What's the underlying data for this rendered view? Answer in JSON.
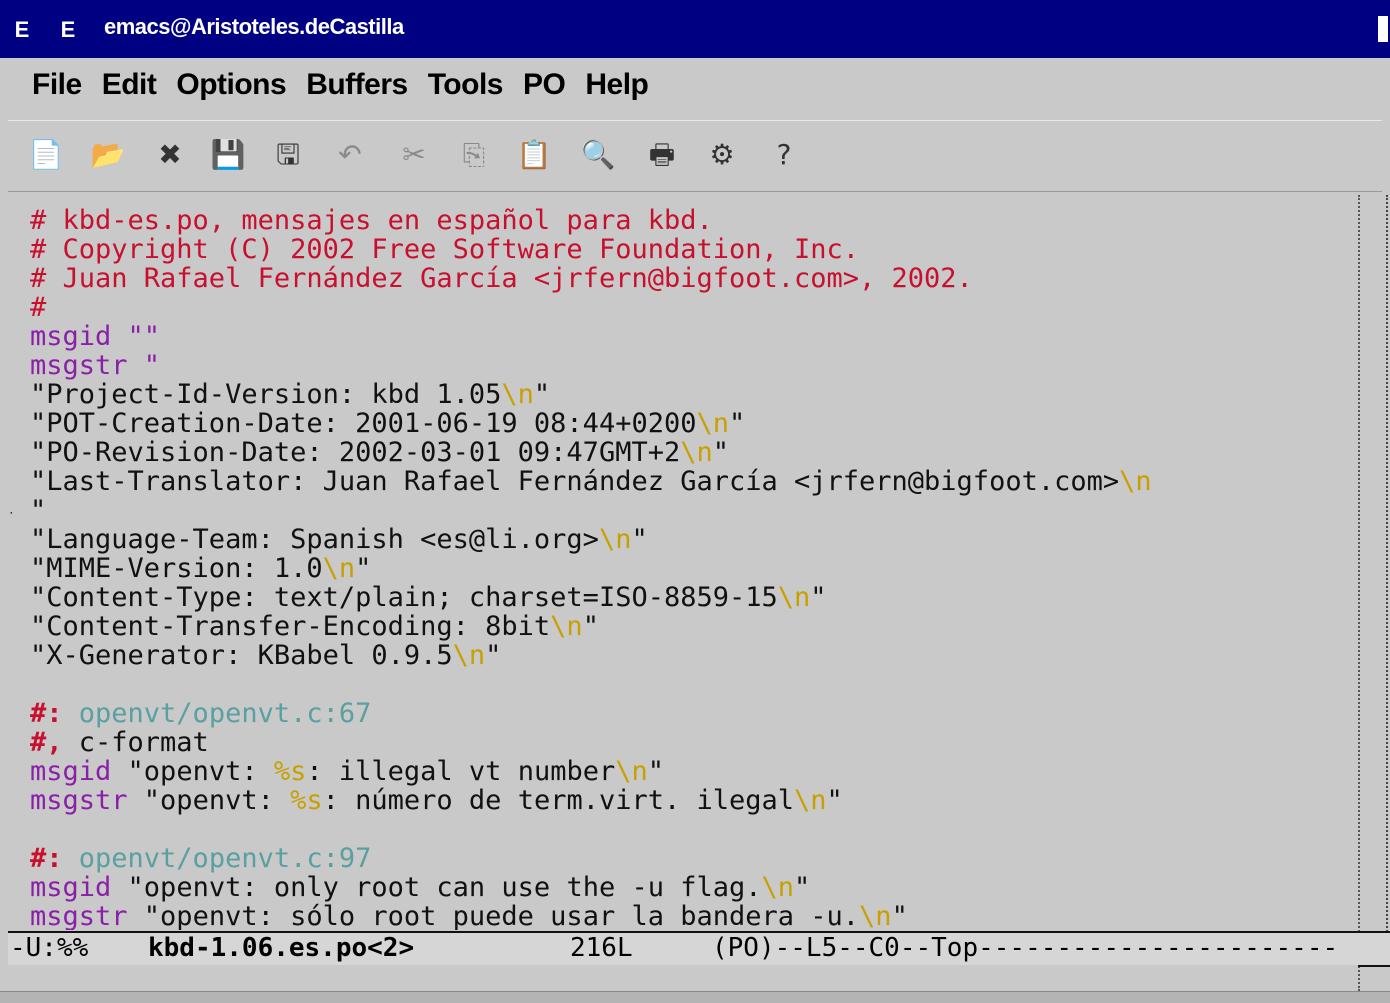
{
  "window": {
    "icon_left": "E",
    "icon_left2": "E",
    "title": "emacs@Aristoteles.deCastilla"
  },
  "menu": [
    "File",
    "Edit",
    "Options",
    "Buffers",
    "Tools",
    "PO",
    "Help"
  ],
  "toolbar": {
    "icons": [
      "open-file-icon",
      "open-dir-icon",
      "close-icon",
      "save-icon",
      "save-as-icon",
      "undo-icon",
      "cut-icon",
      "copy-icon",
      "paste-icon",
      "search-icon",
      "print-icon",
      "customize-icon",
      "help-icon"
    ]
  },
  "buffer": {
    "lines": [
      {
        "seg": [
          {
            "c": "comment",
            "t": "# kbd-es.po, mensajes en español para kbd."
          }
        ]
      },
      {
        "seg": [
          {
            "c": "comment",
            "t": "# Copyright (C) 2002 Free Software Foundation, Inc."
          }
        ]
      },
      {
        "seg": [
          {
            "c": "comment",
            "t": "# Juan Rafael Fernández García <jrfern@bigfoot.com>, 2002."
          }
        ]
      },
      {
        "seg": [
          {
            "c": "comment",
            "t": "#"
          }
        ]
      },
      {
        "seg": [
          {
            "c": "kw",
            "t": "msgid \"\""
          }
        ]
      },
      {
        "seg": [
          {
            "c": "kw",
            "t": "msgstr \""
          }
        ]
      },
      {
        "seg": [
          {
            "c": "",
            "t": "\"Project-Id-Version: kbd 1.05"
          },
          {
            "c": "esc",
            "t": "\\n"
          },
          {
            "c": "",
            "t": "\""
          }
        ]
      },
      {
        "seg": [
          {
            "c": "",
            "t": "\"POT-Creation-Date: 2001-06-19 08:44+0200"
          },
          {
            "c": "esc",
            "t": "\\n"
          },
          {
            "c": "",
            "t": "\""
          }
        ]
      },
      {
        "seg": [
          {
            "c": "",
            "t": "\"PO-Revision-Date: 2002-03-01 09:47GMT+2"
          },
          {
            "c": "esc",
            "t": "\\n"
          },
          {
            "c": "",
            "t": "\""
          }
        ]
      },
      {
        "seg": [
          {
            "c": "",
            "t": "\"Last-Translator: Juan Rafael Fernández García <jrfern@bigfoot.com>"
          },
          {
            "c": "esc",
            "t": "\\n"
          }
        ]
      },
      {
        "seg": [
          {
            "c": "",
            "t": "\""
          }
        ]
      },
      {
        "seg": [
          {
            "c": "",
            "t": "\"Language-Team: Spanish <es@li.org>"
          },
          {
            "c": "esc",
            "t": "\\n"
          },
          {
            "c": "",
            "t": "\""
          }
        ]
      },
      {
        "seg": [
          {
            "c": "",
            "t": "\"MIME-Version: 1.0"
          },
          {
            "c": "esc",
            "t": "\\n"
          },
          {
            "c": "",
            "t": "\""
          }
        ]
      },
      {
        "seg": [
          {
            "c": "",
            "t": "\"Content-Type: text/plain; charset=ISO-8859-15"
          },
          {
            "c": "esc",
            "t": "\\n"
          },
          {
            "c": "",
            "t": "\""
          }
        ]
      },
      {
        "seg": [
          {
            "c": "",
            "t": "\"Content-Transfer-Encoding: 8bit"
          },
          {
            "c": "esc",
            "t": "\\n"
          },
          {
            "c": "",
            "t": "\""
          }
        ]
      },
      {
        "seg": [
          {
            "c": "",
            "t": "\"X-Generator: KBabel 0.9.5"
          },
          {
            "c": "esc",
            "t": "\\n"
          },
          {
            "c": "",
            "t": "\""
          }
        ]
      },
      {
        "seg": [
          {
            "c": "",
            "t": ""
          }
        ]
      },
      {
        "seg": [
          {
            "c": "hash",
            "t": "#:"
          },
          {
            "c": "ref",
            "t": " openvt/openvt.c:67"
          }
        ]
      },
      {
        "seg": [
          {
            "c": "hash",
            "t": "#,"
          },
          {
            "c": "",
            "t": " c-format"
          }
        ]
      },
      {
        "seg": [
          {
            "c": "kw",
            "t": "msgid "
          },
          {
            "c": "",
            "t": "\"openvt: "
          },
          {
            "c": "esc",
            "t": "%s"
          },
          {
            "c": "",
            "t": ": illegal vt number"
          },
          {
            "c": "esc",
            "t": "\\n"
          },
          {
            "c": "",
            "t": "\""
          }
        ]
      },
      {
        "seg": [
          {
            "c": "kw",
            "t": "msgstr "
          },
          {
            "c": "",
            "t": "\"openvt: "
          },
          {
            "c": "esc",
            "t": "%s"
          },
          {
            "c": "",
            "t": ": número de term.virt. ilegal"
          },
          {
            "c": "esc",
            "t": "\\n"
          },
          {
            "c": "",
            "t": "\""
          }
        ]
      },
      {
        "seg": [
          {
            "c": "",
            "t": ""
          }
        ]
      },
      {
        "seg": [
          {
            "c": "hash",
            "t": "#:"
          },
          {
            "c": "ref",
            "t": " openvt/openvt.c:97"
          }
        ]
      },
      {
        "seg": [
          {
            "c": "kw",
            "t": "msgid "
          },
          {
            "c": "",
            "t": "\"openvt: only root can use the -u flag."
          },
          {
            "c": "esc",
            "t": "\\n"
          },
          {
            "c": "",
            "t": "\""
          }
        ]
      },
      {
        "seg": [
          {
            "c": "kw",
            "t": "msgstr "
          },
          {
            "c": "",
            "t": "\"openvt: sólo root puede usar la bandera -u."
          },
          {
            "c": "esc",
            "t": "\\n"
          },
          {
            "c": "",
            "t": "\""
          }
        ]
      }
    ]
  },
  "modeline": {
    "flags": "-U:%%",
    "buffer_name": "kbd-1.06.es.po<2>",
    "stats": "216L",
    "mode_line_rest": "(PO)--L5--C0--Top-----------------------"
  }
}
